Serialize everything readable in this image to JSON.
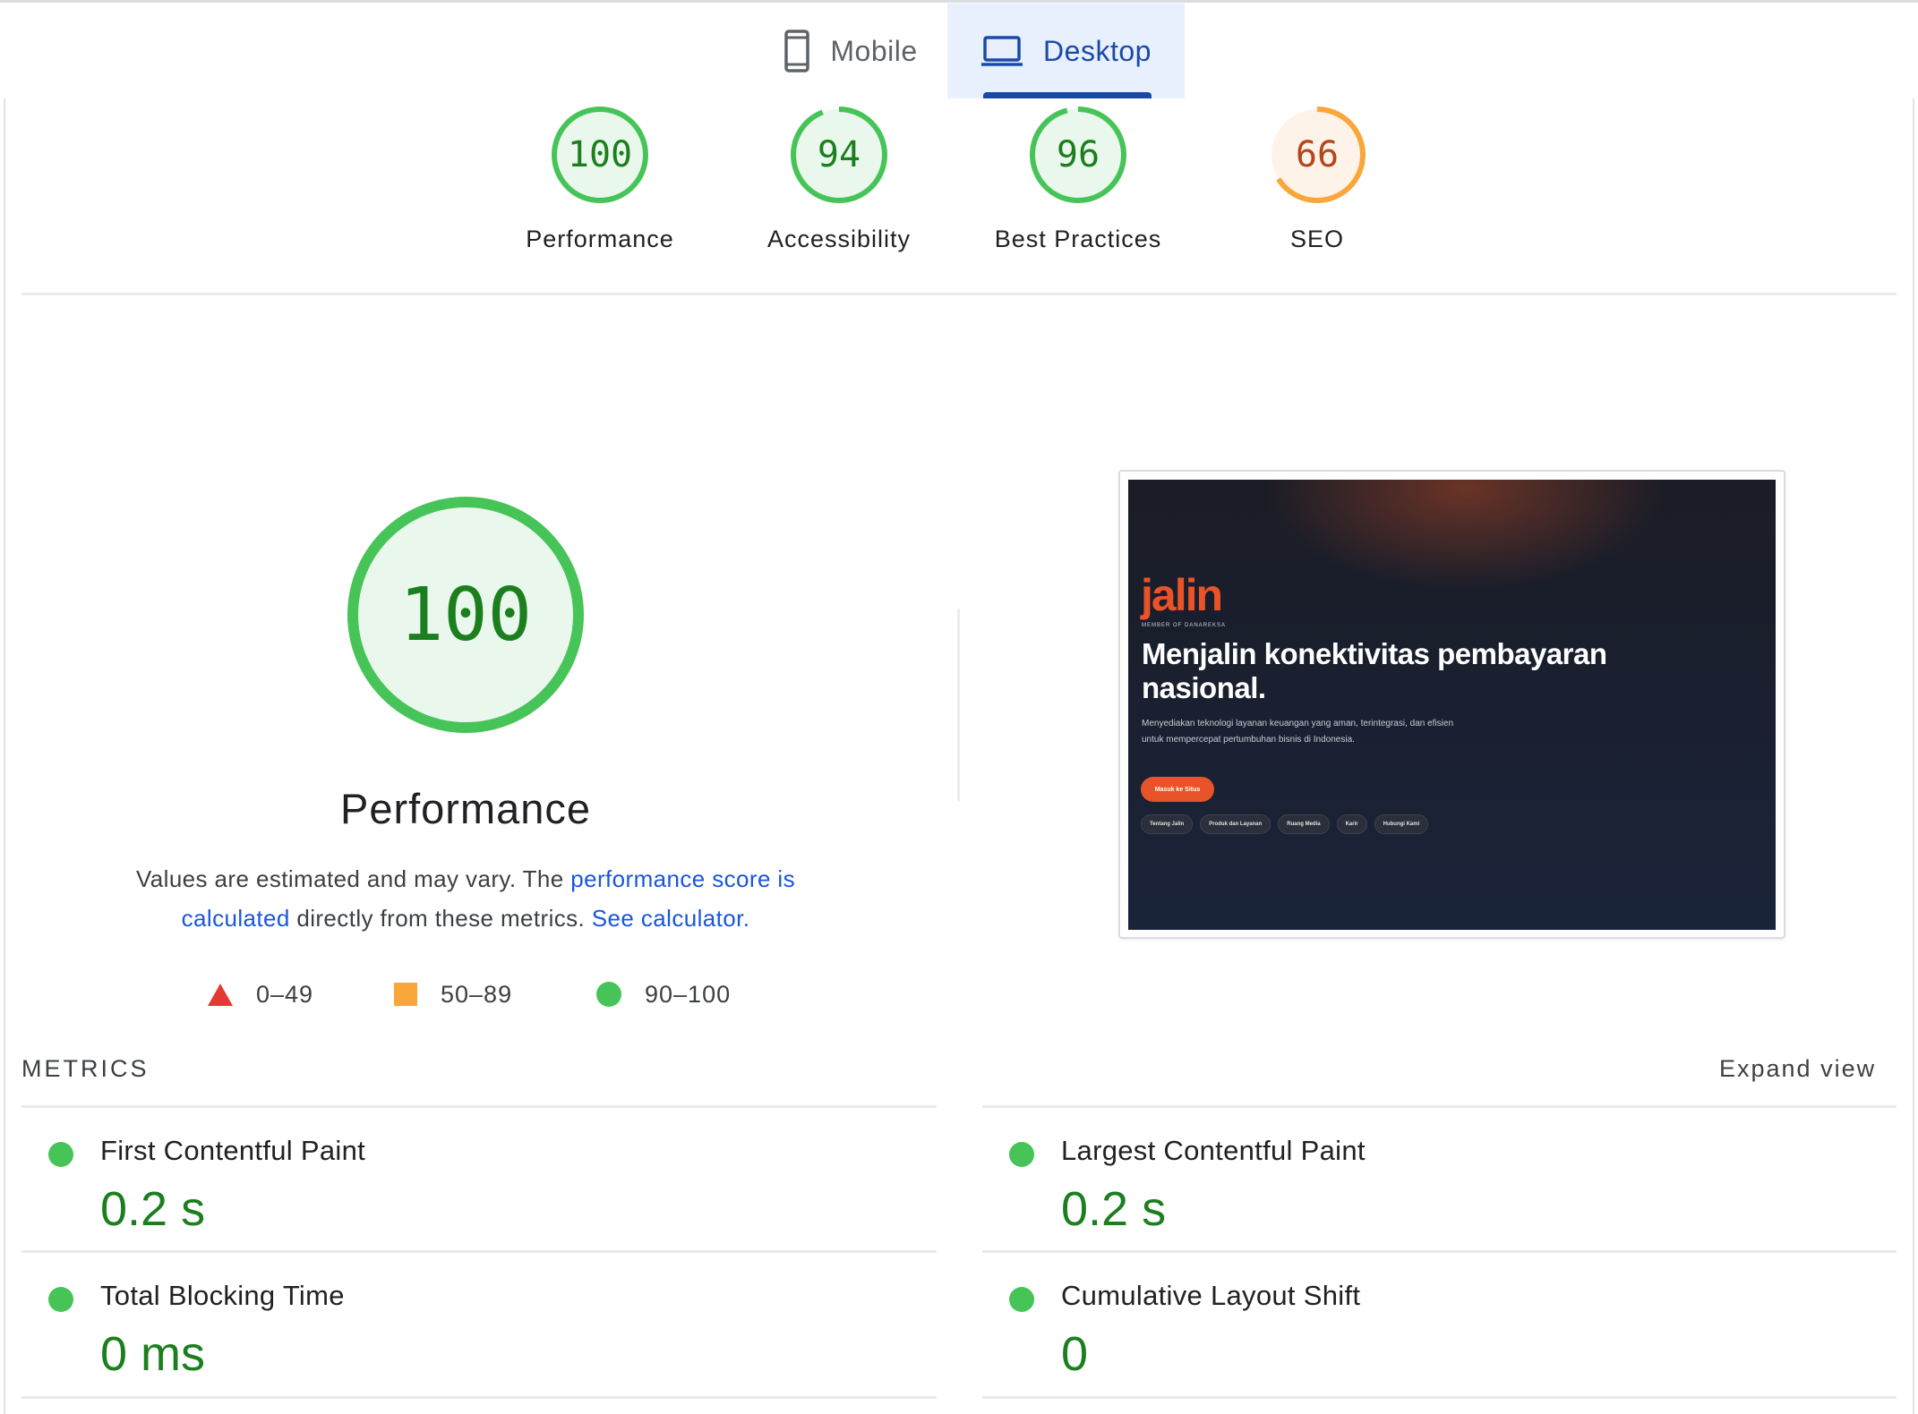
{
  "tabs": {
    "mobile": {
      "label": "Mobile",
      "icon": "phone-icon"
    },
    "desktop": {
      "label": "Desktop",
      "icon": "laptop-icon",
      "selected": true
    }
  },
  "scores": [
    {
      "label": "Performance",
      "value": "100",
      "fraction": 1.0,
      "status": "good"
    },
    {
      "label": "Accessibility",
      "value": "94",
      "fraction": 0.94,
      "status": "good"
    },
    {
      "label": "Best Practices",
      "value": "96",
      "fraction": 0.96,
      "status": "good"
    },
    {
      "label": "SEO",
      "value": "66",
      "fraction": 0.66,
      "status": "average"
    }
  ],
  "colors": {
    "good_ring": "#46c457",
    "good_fill": "#eaf7ec",
    "good_text": "#1b7f1e",
    "avg_ring": "#f9a63b",
    "avg_fill": "#fdf3e8",
    "avg_text": "#b3471b",
    "link": "#1a56db",
    "tab_active": "#1a4aa8"
  },
  "performance": {
    "score": "100",
    "fraction": 1.0,
    "title": "Performance",
    "desc_prefix": "Values are estimated and may vary. The ",
    "desc_link1": "performance score is calculated",
    "desc_middle": " directly from these metrics. ",
    "desc_link2": "See calculator."
  },
  "legend": [
    {
      "icon": "fail-triangle-icon",
      "range": "0–49"
    },
    {
      "icon": "average-square-icon",
      "range": "50–89"
    },
    {
      "icon": "pass-circle-icon",
      "range": "90–100"
    }
  ],
  "preview": {
    "logo": "jalin",
    "subtitle": "MEMBER OF DANAREKSA",
    "headline": "Menjalin konektivitas pembayaran nasional.",
    "body": "Menyediakan teknologi layanan keuangan yang aman, terintegrasi, dan efisien untuk mempercepat pertumbuhan bisnis di Indonesia.",
    "cta": "Masuk ke Situs",
    "pills": [
      "Tentang Jalin",
      "Produk dan Layanan",
      "Ruang Media",
      "Karir",
      "Hubungi Kami"
    ]
  },
  "metrics": {
    "title": "METRICS",
    "expand_label": "Expand view",
    "items": [
      {
        "name": "First Contentful Paint",
        "value": "0.2 s"
      },
      {
        "name": "Largest Contentful Paint",
        "value": "0.2 s"
      },
      {
        "name": "Total Blocking Time",
        "value": "0 ms"
      },
      {
        "name": "Cumulative Layout Shift",
        "value": "0"
      }
    ]
  }
}
